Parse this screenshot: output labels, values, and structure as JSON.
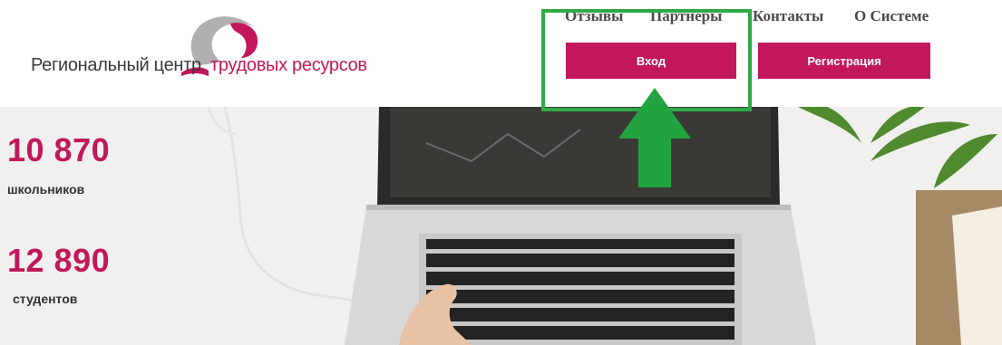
{
  "brand": {
    "name_left": "Региональный центр",
    "name_right": "трудовых ресурсов",
    "accent_color": "#c2185b",
    "logo_icon": "swoosh-logo-icon"
  },
  "nav": {
    "links": [
      "Отзывы",
      "Партнеры",
      "Контакты",
      "О Системе"
    ]
  },
  "buttons": {
    "login": "Вход",
    "register": "Регистрация"
  },
  "annotation": {
    "highlight_color": "#2eaa46",
    "arrow_icon": "up-arrow-icon",
    "target": "Вход"
  },
  "stats": [
    {
      "value": "10 870",
      "label": "школьников"
    },
    {
      "value": "12 890",
      "label": "студентов"
    }
  ]
}
